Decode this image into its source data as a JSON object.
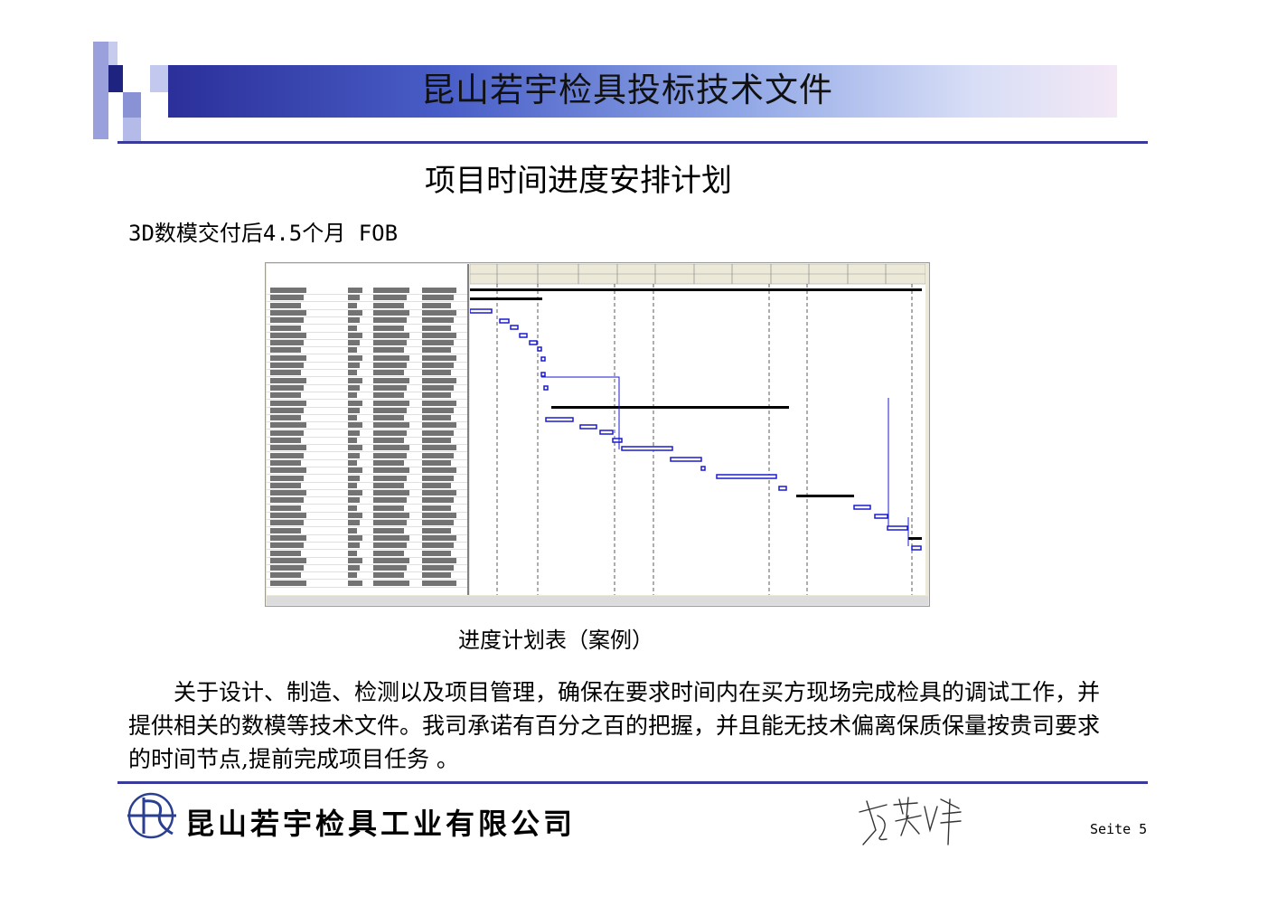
{
  "header": {
    "title": "昆山若宇检具投标技术文件",
    "accent_color": "#2b2f9a"
  },
  "page_heading": "项目时间进度安排计划",
  "subtitle": "3D数模交付后4.5个月 FOB",
  "gantt": {
    "caption": "进度计划表（案例）"
  },
  "body": {
    "paragraph": "关于设计、制造、检测以及项目管理，确保在要求时间内在买方现场完成检具的调试工作，并提供相关的数模等技术文件。我司承诺有百分之百的把握，并且能无技术偏离保质保量按贵司要求的时间节点,提前完成项目任务 。"
  },
  "footer": {
    "logo_icon": "company-logo-icon",
    "company_name": "昆山若宇检具工业有限公司",
    "signature_text": "李荣峰",
    "page_number": "Seite 5"
  }
}
